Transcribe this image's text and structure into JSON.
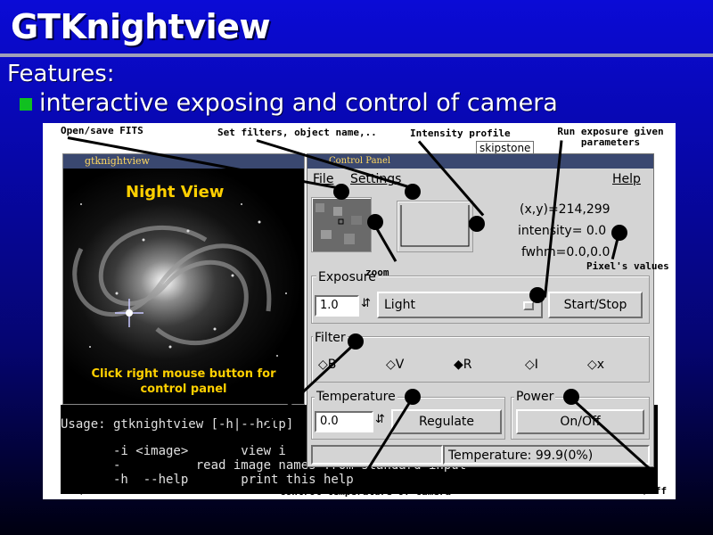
{
  "slide": {
    "title": "GTKnightview",
    "section": "Features:",
    "bullet": "interactive exposing and control of camera",
    "bullet_color": "#10c020"
  },
  "annotations": {
    "open_save": "Open/save FITS",
    "set_filters": "Set filters, object name,..",
    "intensity_profile": "Intensity profile",
    "run_exposure": "Run exposure given parameters",
    "zoom": "zoom",
    "pixel_values": "Pixel's values",
    "set_select_filter": "Set/select filter",
    "control_temperature": "control temperature of camera",
    "switch_onoff": "switch on/off"
  },
  "skipstone": "skipstone",
  "terminal": {
    "usage": "Usage: gtknightview [-h|--help]",
    "line2": "       -i <image>       view i",
    "line3": "       -          read image names from standard input",
    "line4": "       -h  --help       print this help"
  },
  "nightview_window": {
    "title": "gtknightview",
    "image_title": "Night View",
    "image_help": "Click right mouse button for control panel"
  },
  "control_panel": {
    "title": "Control Panel",
    "menu": {
      "file": "File",
      "settings": "Settings",
      "help": "Help"
    },
    "readout": {
      "coords": "(x,y)=214,299",
      "intensity": "intensity=  0.0",
      "fwhm": "fwhm=0.0,0.0"
    },
    "exposure": {
      "label": "Exposure",
      "value": "1.0",
      "type": "Light",
      "start_stop": "Start/Stop"
    },
    "filter": {
      "label": "Filter",
      "options": [
        "B",
        "V",
        "R",
        "I",
        "x"
      ],
      "selected": "R"
    },
    "temperature": {
      "label": "Temperature",
      "value": "0.0",
      "regulate": "Regulate"
    },
    "power": {
      "label": "Power",
      "onoff": "On/Off"
    },
    "status": "Temperature:  99.9(0%)"
  }
}
